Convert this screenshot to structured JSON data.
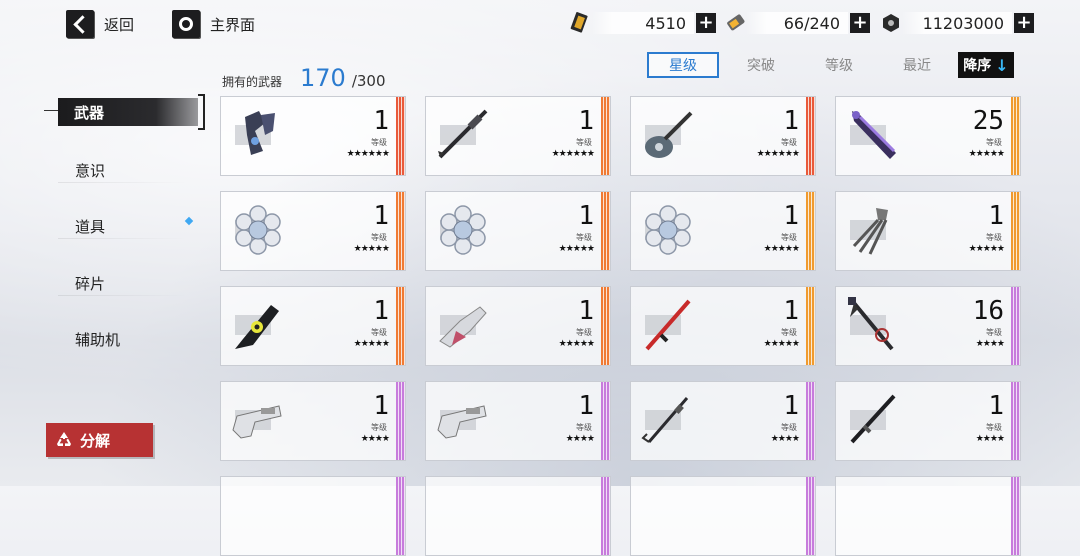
{
  "header": {
    "back_label": "返回",
    "home_label": "主界面",
    "resources": [
      {
        "icon": "gold-ticket-icon",
        "value": "4510"
      },
      {
        "icon": "stamina-battery-icon",
        "value": "66/240"
      },
      {
        "icon": "coin-icon",
        "value": "11203000"
      }
    ],
    "plus_glyph": "+"
  },
  "inventory": {
    "owned_label": "拥有的武器",
    "owned_count": "170",
    "capacity": "/300"
  },
  "sort": {
    "options": [
      "星级",
      "突破",
      "等级",
      "最近"
    ],
    "active": "星级",
    "order_label": "降序",
    "order_arrow": "↓"
  },
  "nav": {
    "items": [
      "武器",
      "意识",
      "道具",
      "碎片",
      "辅助机"
    ],
    "active": "武器"
  },
  "decompose_label": "分解",
  "level_label": "等级",
  "colors": {
    "accent_blue": "#2b7bcf",
    "decompose_red": "#b73233",
    "rarity_red": "#e9593a",
    "rarity_orange": "#f07a33",
    "rarity_purple": "#c77bdc"
  },
  "weapons": [
    {
      "icon": "twin-pistols-icon",
      "level": "1",
      "stars": "★★★★★★",
      "rarity": "red"
    },
    {
      "icon": "spear-icon",
      "level": "1",
      "stars": "★★★★★★",
      "rarity": "orange"
    },
    {
      "icon": "pipa-lute-icon",
      "level": "1",
      "stars": "★★★★★★",
      "rarity": "red"
    },
    {
      "icon": "purple-greatsword-icon",
      "level": "25",
      "stars": "★★★★★",
      "rarity": "orange2"
    },
    {
      "icon": "crystal-flower-icon",
      "level": "1",
      "stars": "★★★★★",
      "rarity": "orange"
    },
    {
      "icon": "crystal-flower-icon",
      "level": "1",
      "stars": "★★★★★",
      "rarity": "orange"
    },
    {
      "icon": "crystal-flower-icon",
      "level": "1",
      "stars": "★★★★★",
      "rarity": "orange2"
    },
    {
      "icon": "claw-gauntlet-icon",
      "level": "1",
      "stars": "★★★★★",
      "rarity": "orange2"
    },
    {
      "icon": "chainsaw-blade-icon",
      "level": "1",
      "stars": "★★★★★",
      "rarity": "orange"
    },
    {
      "icon": "mecha-cannon-icon",
      "level": "1",
      "stars": "★★★★★",
      "rarity": "orange"
    },
    {
      "icon": "red-katana-icon",
      "level": "1",
      "stars": "★★★★★",
      "rarity": "orange2"
    },
    {
      "icon": "scythe-icon",
      "level": "16",
      "stars": "★★★★",
      "rarity": "purple"
    },
    {
      "icon": "rifle-icon",
      "level": "1",
      "stars": "★★★★",
      "rarity": "purple"
    },
    {
      "icon": "rifle-icon",
      "level": "1",
      "stars": "★★★★",
      "rarity": "purple"
    },
    {
      "icon": "hook-spear-icon",
      "level": "1",
      "stars": "★★★★",
      "rarity": "purple"
    },
    {
      "icon": "black-katana-icon",
      "level": "1",
      "stars": "★★★★",
      "rarity": "purple"
    }
  ]
}
